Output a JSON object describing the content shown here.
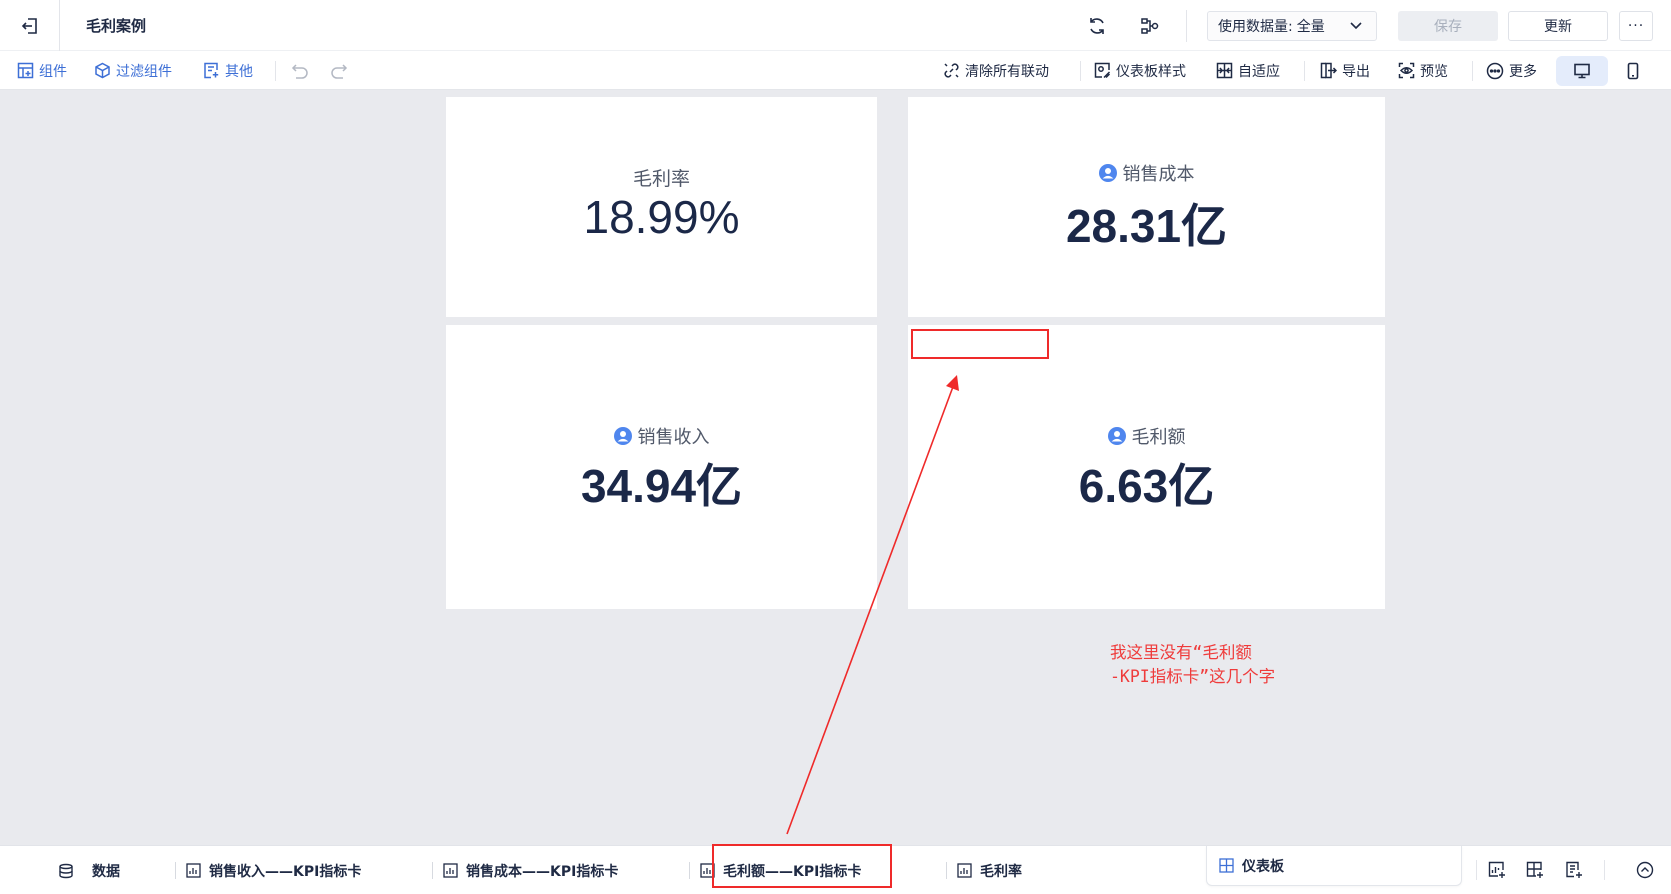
{
  "header": {
    "title": "毛利案例",
    "data_amount_label": "使用数据量:",
    "data_amount_value": "全量",
    "save_label": "保存",
    "update_label": "更新",
    "more_label": "···"
  },
  "toolbar": {
    "left": [
      {
        "label": "组件",
        "icon": "add-component-icon"
      },
      {
        "label": "过滤组件",
        "icon": "filter-cube-icon"
      },
      {
        "label": "其他",
        "icon": "other-icon"
      }
    ],
    "right": [
      {
        "label": "清除所有联动",
        "icon": "unlink-icon"
      },
      {
        "label": "仪表板样式",
        "icon": "dashboard-style-icon"
      },
      {
        "label": "自适应",
        "icon": "adaptive-icon"
      },
      {
        "label": "导出",
        "icon": "export-icon"
      },
      {
        "label": "预览",
        "icon": "preview-icon"
      },
      {
        "label": "更多",
        "icon": "more-circle-icon"
      }
    ]
  },
  "cards": [
    {
      "label": "毛利率",
      "value": "18.99%",
      "has_person_icon": false
    },
    {
      "label": "销售成本",
      "value": "28.31亿",
      "has_person_icon": true
    },
    {
      "label": "销售收入",
      "value": "34.94亿",
      "has_person_icon": true
    },
    {
      "label": "毛利额",
      "value": "6.63亿",
      "has_person_icon": true
    }
  ],
  "annotation": {
    "line1": "我这里没有“毛利额",
    "line2": "-KPI指标卡”这几个字",
    "color": "#ef2a2a"
  },
  "tabs": [
    {
      "label": "数据",
      "icon": "database-icon"
    },
    {
      "label": "销售收入——KPI指标卡",
      "icon": "chart-icon"
    },
    {
      "label": "销售成本——KPI指标卡",
      "icon": "chart-icon"
    },
    {
      "label": "毛利额——KPI指标卡",
      "icon": "chart-icon"
    },
    {
      "label": "毛利率",
      "icon": "chart-icon"
    }
  ],
  "active_tab": {
    "label": "仪表板",
    "icon": "dashboard-icon"
  },
  "colors": {
    "accent": "#3d6fd6",
    "value_text": "#1b2848",
    "canvas": "#e9eaee"
  }
}
